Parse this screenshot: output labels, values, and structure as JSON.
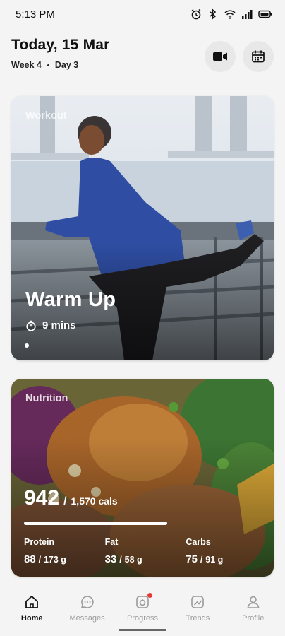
{
  "status_bar": {
    "time": "5:13 PM"
  },
  "header": {
    "date": "Today, 15 Mar",
    "week": "Week 4",
    "day": "Day 3"
  },
  "workout": {
    "label": "Workout",
    "title": "Warm Up",
    "duration": "9 mins"
  },
  "nutrition": {
    "label": "Nutrition",
    "calories": "942",
    "calories_target": "1,570 cals",
    "calorie_progress": 0.6,
    "macros": [
      {
        "name": "Protein",
        "value": "88",
        "target": "173 g"
      },
      {
        "name": "Fat",
        "value": "33",
        "target": "58 g"
      },
      {
        "name": "Carbs",
        "value": "75",
        "target": "91 g"
      }
    ]
  },
  "tabs": [
    {
      "label": "Home",
      "icon": "home-icon",
      "active": true
    },
    {
      "label": "Messages",
      "icon": "chat-icon",
      "active": false
    },
    {
      "label": "Progress",
      "icon": "progress-icon",
      "active": false
    },
    {
      "label": "Trends",
      "icon": "trends-icon",
      "active": false
    },
    {
      "label": "Profile",
      "icon": "profile-icon",
      "active": false
    }
  ],
  "colors": {
    "accent_badge": "#e53935"
  }
}
